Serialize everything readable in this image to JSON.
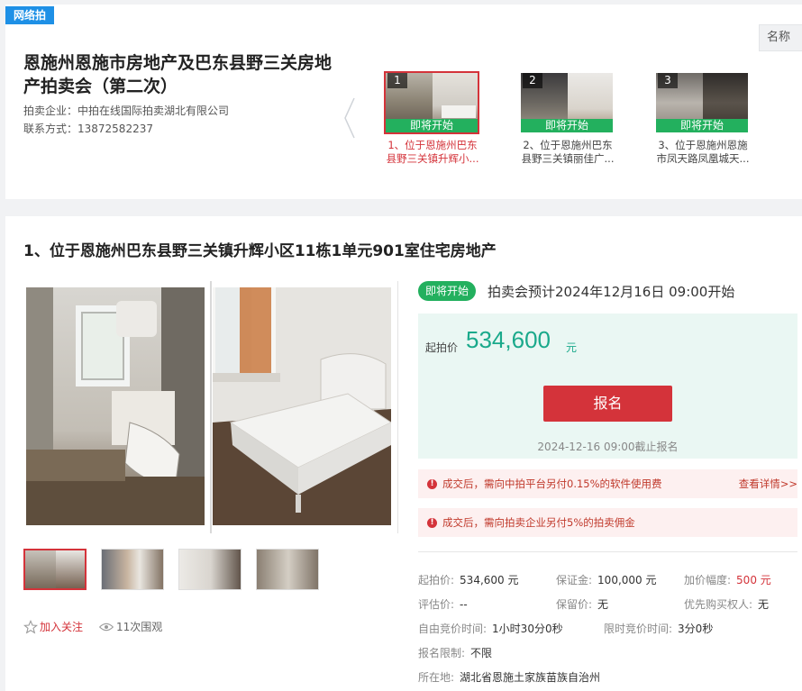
{
  "header": {
    "tag": "网络拍",
    "title": "恩施州恩施市房地产及巴东县野三关房地产拍卖会（第二次）",
    "company_label": "拍卖企业：中拍在线国际拍卖湖北有限公司",
    "contact_label": "联系方式：13872582237",
    "name_tab": "名称"
  },
  "lots": [
    {
      "num": "1",
      "status": "即将开始",
      "name": "1、位于恩施州巴东县野三关镇升辉小..."
    },
    {
      "num": "2",
      "status": "即将开始",
      "name": "2、位于恩施州巴东县野三关镇丽佳广..."
    },
    {
      "num": "3",
      "status": "即将开始",
      "name": "3、位于恩施州恩施市凤天路凤凰城天..."
    }
  ],
  "item": {
    "title": "1、位于恩施州巴东县野三关镇升辉小区11栋1单元901室住宅房地产",
    "status": "即将开始",
    "start_time": "拍卖会预计2024年12月16日  09:00开始",
    "price_label": "起拍价",
    "price": "534,600",
    "price_unit": "元",
    "signup": "报名",
    "deadline": "2024-12-16 09:00截止报名",
    "notice1": "成交后，需向中拍平台另付0.15%的软件使用费",
    "notice1_link": "查看详情>>",
    "notice2": "成交后，需向拍卖企业另付5%的拍卖佣金",
    "follow": "加入关注",
    "views": "11次围观"
  },
  "details": {
    "start_price_label": "起拍价:",
    "start_price": "534,600 元",
    "deposit_label": "保证金:",
    "deposit": "100,000 元",
    "increment_label": "加价幅度:",
    "increment": "500 元",
    "appraisal_label": "评估价:",
    "appraisal": "--",
    "reserve_label": "保留价:",
    "reserve": "无",
    "priority_label": "优先购买权人:",
    "priority": "无",
    "free_bid_label": "自由竞价时间:",
    "free_bid": "1小时30分0秒",
    "limit_bid_label": "限时竞价时间:",
    "limit_bid": "3分0秒",
    "signup_limit_label": "报名限制:",
    "signup_limit": "不限",
    "location_label": "所在地:",
    "location": "湖北省恩施土家族苗族自治州"
  },
  "colors": {
    "accent_red": "#d4333a",
    "status_green": "#23b05e",
    "price_teal": "#1aa98b",
    "tag_blue": "#1e90e6"
  }
}
